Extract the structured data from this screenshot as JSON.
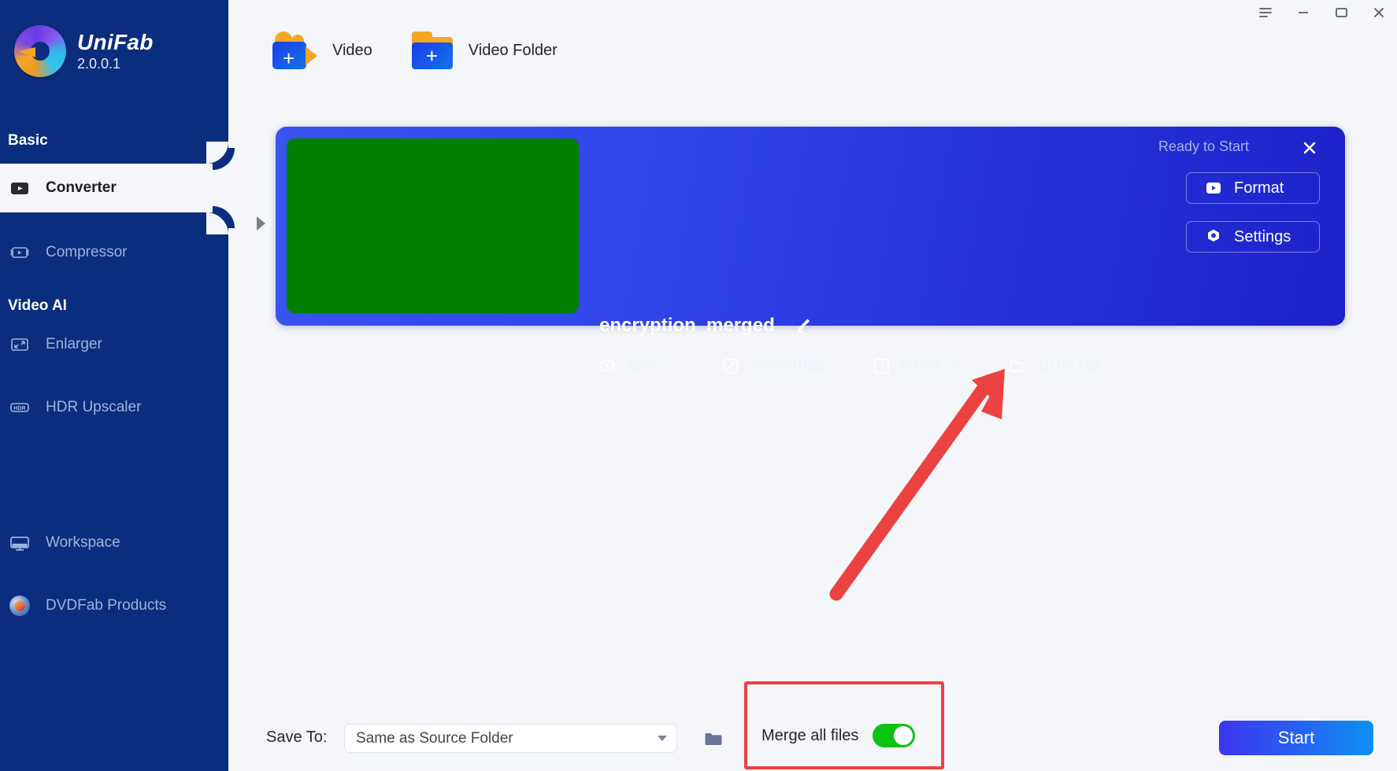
{
  "app": {
    "brand_name": "UniFab",
    "version": "2.0.0.1"
  },
  "window_controls": {
    "menu": "menu-icon",
    "minimize": "minimize-icon",
    "maximize": "maximize-icon",
    "close": "close-icon"
  },
  "sidebar": {
    "groups": [
      {
        "title": "Basic"
      },
      {
        "title": "Video AI"
      }
    ],
    "items": [
      {
        "label": "Converter",
        "icon": "converter-icon",
        "active": true
      },
      {
        "label": "Compressor",
        "icon": "compressor-icon",
        "active": false
      },
      {
        "label": "Enlarger",
        "icon": "enlarger-icon",
        "active": false
      },
      {
        "label": "HDR Upscaler",
        "icon": "hdr-icon",
        "active": false
      },
      {
        "label": "Workspace",
        "icon": "monitor-icon",
        "active": false
      },
      {
        "label": "DVDFab Products",
        "icon": "dvdfab-icon",
        "active": false
      }
    ]
  },
  "source_bar": {
    "buttons": [
      {
        "label": "Video",
        "icon": "add-video-icon"
      },
      {
        "label": "Video Folder",
        "icon": "add-video-folder-icon"
      }
    ]
  },
  "media_card": {
    "title": "encryption_merged",
    "status": "Ready to Start",
    "thumbnail_color": "#018000",
    "meta": [
      {
        "key": "format",
        "icon": "video-file-icon",
        "value": "MP4"
      },
      {
        "key": "resolution",
        "icon": "resolution-icon",
        "value": "1920x1080"
      },
      {
        "key": "duration",
        "icon": "clock-icon",
        "value": "00:00:12"
      },
      {
        "key": "size",
        "icon": "folder-icon",
        "value": "10.00 MB"
      }
    ],
    "buttons": [
      {
        "label": "Format",
        "icon": "play-box-icon"
      },
      {
        "label": "Settings",
        "icon": "gear-icon"
      }
    ]
  },
  "bottom_bar": {
    "save_to_label": "Save To:",
    "save_to_value": "Same as Source Folder",
    "save_to_placeholder": "Same as Source Folder",
    "browse_icon": "folder-open-icon",
    "merge_label": "Merge all files",
    "merge_enabled": true,
    "start_label": "Start"
  },
  "annotations": {
    "arrow_color": "#ec4141",
    "rect_color": "#ec4141"
  }
}
